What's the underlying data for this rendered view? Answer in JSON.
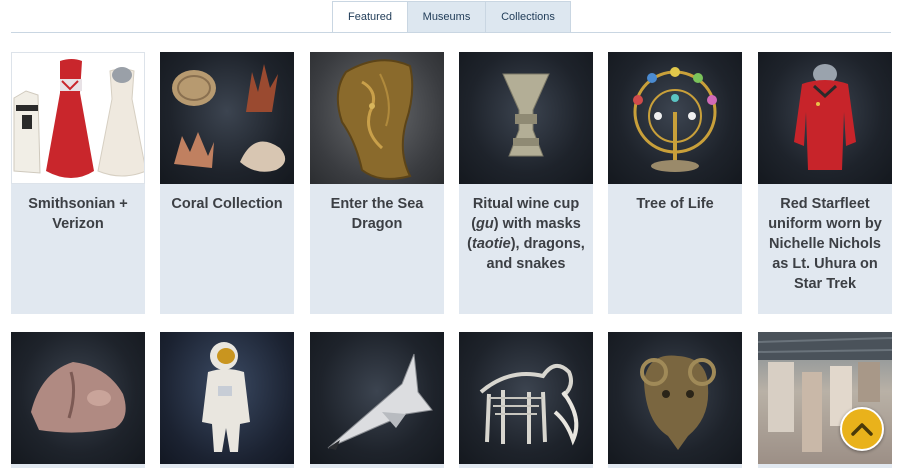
{
  "tabs": [
    {
      "label": "Featured",
      "active": true
    },
    {
      "label": "Museums",
      "active": false
    },
    {
      "label": "Collections",
      "active": false
    }
  ],
  "cards_row1": [
    {
      "title": "Smithsonian + Verizon",
      "icon": "clothing-collection-thumbnail"
    },
    {
      "title": "Coral Collection",
      "icon": "coral-collection-thumbnail"
    },
    {
      "title": "Enter the Sea Dragon",
      "icon": "sea-dragon-fossil-thumbnail"
    },
    {
      "title_parts": [
        "Ritual wine cup (",
        "gu",
        ") with masks (",
        "taotie",
        "), dragons, and snakes"
      ],
      "icon": "bronze-wine-cup-thumbnail"
    },
    {
      "title": "Tree of Life",
      "icon": "tree-of-life-sculpture-thumbnail"
    },
    {
      "title": "Red Starfleet uniform worn by Nichelle Nichols as Lt. Uhura on Star Trek",
      "icon": "starfleet-uniform-thumbnail"
    }
  ],
  "cards_row2": [
    {
      "icon": "rock-specimen-thumbnail"
    },
    {
      "icon": "astronaut-spacesuit-thumbnail"
    },
    {
      "icon": "space-shuttle-thumbnail"
    },
    {
      "icon": "mammoth-skeleton-thumbnail"
    },
    {
      "icon": "bronze-ram-head-thumbnail"
    },
    {
      "icon": "industrial-interior-thumbnail"
    }
  ],
  "colors": {
    "tab_bg": "#dde7f0",
    "card_bg": "#e1e8f0",
    "title_text": "#3c3f44",
    "scroll_button": "#e9b21b"
  },
  "scroll_top": {
    "icon": "chevron-up-icon"
  }
}
